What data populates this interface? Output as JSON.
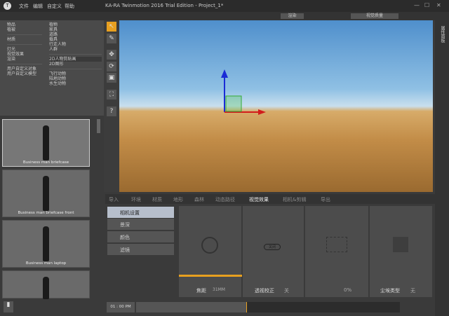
{
  "window": {
    "title": "KA-RA Twinmotion 2016 Trial Edition - Project_1*",
    "logo": "T",
    "minimize": "—",
    "maximize": "☐",
    "close": "✕"
  },
  "menu": [
    "文件",
    "编辑",
    "自定义",
    "帮助"
  ],
  "toolbar": {
    "render": "渲染",
    "quality": "视觉质量"
  },
  "library": {
    "col1": [
      "物品",
      "植被",
      "材质",
      "灯光",
      "视觉效果",
      "渲染",
      "用户自定义对象",
      "用户自定义模型"
    ],
    "col2": [
      "植物",
      "家具",
      "道路",
      "载具",
      "行走人物",
      "人群",
      "2D人物剪贴画",
      "2D图形",
      "飞行动物",
      "陆地动物",
      "水生动物"
    ]
  },
  "thumbnails": [
    "Business man briefcase",
    "Business man briefcase front",
    "Business man laptop"
  ],
  "tools": {
    "select": "↖",
    "paint": "✎",
    "move": "✥",
    "rotate": "⟳",
    "scale": "▣",
    "frame": "⛶",
    "help": "?"
  },
  "right_panel": "属性面板",
  "tabs": [
    "导入",
    "环境",
    "材质",
    "地形",
    "森林",
    "动态路径",
    "视觉效果",
    "相机&剪辑",
    "导出"
  ],
  "active_tab": "视觉效果",
  "subtabs": [
    "相机设置",
    "景深",
    "颜色",
    "滤镜"
  ],
  "cards": [
    {
      "label": "焦距",
      "value": "31MM"
    },
    {
      "label": "透视校正",
      "value": "关",
      "toggle": "关闭"
    },
    {
      "label": "",
      "value": "0%"
    },
    {
      "label": "尘埃类型",
      "value": "无"
    }
  ],
  "timeline": {
    "time": "01 : 00 PM",
    "progress": 0.42
  },
  "accent": "#e8a020"
}
